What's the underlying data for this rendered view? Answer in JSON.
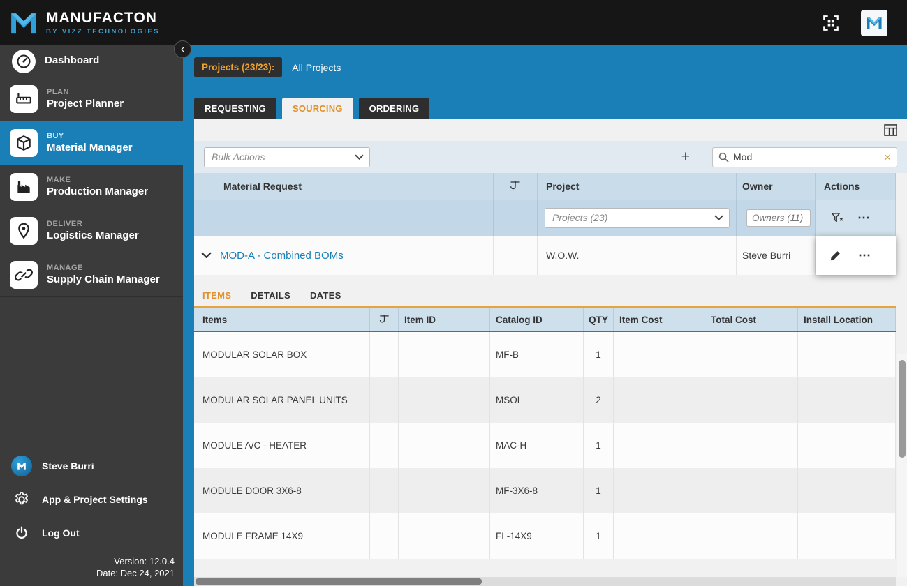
{
  "brand": {
    "name": "MANUFACTON",
    "tagline": "BY VIZZ TECHNOLOGIES"
  },
  "colors": {
    "accent_blue": "#1a7fb6",
    "accent_orange": "#e8a33d",
    "sidebar_dark": "#3b3b3b"
  },
  "sidebar": {
    "items": [
      {
        "category": "",
        "label": "Dashboard"
      },
      {
        "category": "PLAN",
        "label": "Project Planner"
      },
      {
        "category": "BUY",
        "label": "Material Manager"
      },
      {
        "category": "MAKE",
        "label": "Production Manager"
      },
      {
        "category": "DELIVER",
        "label": "Logistics Manager"
      },
      {
        "category": "MANAGE",
        "label": "Supply Chain Manager"
      }
    ],
    "user_name": "Steve Burri",
    "settings_label": "App & Project Settings",
    "logout_label": "Log Out",
    "version": "Version: 12.0.4",
    "date": "Date: Dec 24, 2021"
  },
  "header": {
    "projects_badge": "Projects (23/23):",
    "projects_value": "All Projects"
  },
  "tabs": {
    "requesting": "REQUESTING",
    "sourcing": "SOURCING",
    "ordering": "ORDERING"
  },
  "toolbar": {
    "bulk_actions_label": "Bulk Actions",
    "add_label": "+",
    "search_value": "Mod"
  },
  "request_table": {
    "col_material_request": "Material Request",
    "col_project": "Project",
    "col_owner": "Owner",
    "col_actions": "Actions",
    "filter_projects": "Projects (23)",
    "filter_owners": "Owners (11)",
    "row": {
      "name": "MOD-A - Combined BOMs",
      "project": "W.O.W.",
      "owner": "Steve Burri"
    }
  },
  "detail_tabs": {
    "items": "ITEMS",
    "details": "DETAILS",
    "dates": "DATES"
  },
  "items_table": {
    "headers": [
      "Items",
      "Item ID",
      "Catalog ID",
      "QTY",
      "Item Cost",
      "Total Cost",
      "Install Location"
    ],
    "rows": [
      {
        "item": "MODULAR SOLAR BOX",
        "item_id": "",
        "catalog_id": "MF-B",
        "qty": "1",
        "item_cost": "",
        "total_cost": "",
        "install_location": ""
      },
      {
        "item": "MODULAR SOLAR PANEL UNITS",
        "item_id": "",
        "catalog_id": "MSOL",
        "qty": "2",
        "item_cost": "",
        "total_cost": "",
        "install_location": ""
      },
      {
        "item": "MODULE A/C - HEATER",
        "item_id": "",
        "catalog_id": "MAC-H",
        "qty": "1",
        "item_cost": "",
        "total_cost": "",
        "install_location": ""
      },
      {
        "item": "MODULE DOOR 3X6-8",
        "item_id": "",
        "catalog_id": "MF-3X6-8",
        "qty": "1",
        "item_cost": "",
        "total_cost": "",
        "install_location": ""
      },
      {
        "item": "MODULE FRAME 14X9",
        "item_id": "",
        "catalog_id": "FL-14X9",
        "qty": "1",
        "item_cost": "",
        "total_cost": "",
        "install_location": ""
      }
    ]
  },
  "icons": {
    "plus": "+",
    "clear": "×",
    "ellipsis": "⋯",
    "collapse": "‹"
  }
}
